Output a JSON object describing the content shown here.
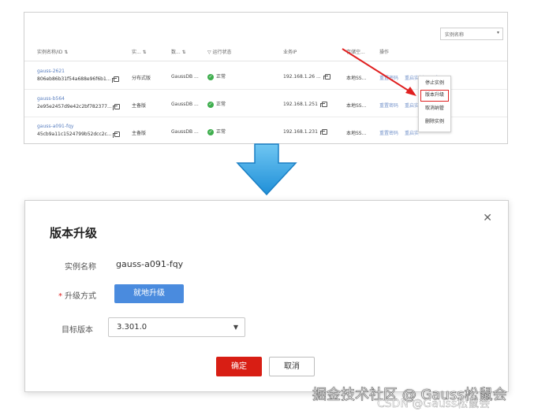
{
  "list": {
    "sort_select": "实例名称",
    "headers": {
      "name": "实例名称/ID",
      "type": "实...",
      "engine": "数...",
      "status": "运行状态",
      "ip": "业务IP",
      "storage": "存储空...",
      "ops": "操作"
    },
    "rows": [
      {
        "name": "gauss-2621",
        "id": "806eb86b31f54a688e96f6b1...",
        "type": "分布式版",
        "engine": "GaussDB ...",
        "status": "正常",
        "ip": "192.168.1.26 ...",
        "storage": "本地SS...",
        "op1": "重置密码",
        "op2": "重启实例",
        "more": "更多"
      },
      {
        "name": "gauss-b564",
        "id": "2e95e2457d9e42c2bf782377...",
        "type": "主备版",
        "engine": "GaussDB ...",
        "status": "正常",
        "ip": "192.168.1.251",
        "storage": "本地SS...",
        "op1": "重置密码",
        "op2": "重启实",
        "more": ""
      },
      {
        "name": "gauss-a091-fqy",
        "id": "45cb9a11c1524799b52dcc2c...",
        "type": "主备版",
        "engine": "GaussDB ...",
        "status": "正常",
        "ip": "192.168.1.231",
        "storage": "本地SS...",
        "op1": "重置密码",
        "op2": "重启实",
        "more": ""
      }
    ],
    "more_menu": [
      "停止实例",
      "版本升级",
      "取消纳管",
      "删除实例"
    ]
  },
  "colors": {
    "accent_blue": "#4a8bde",
    "danger_red": "#d81e14",
    "status_green": "#3fae4e",
    "arrow_blue": "#2a9ee0"
  },
  "dialog": {
    "title": "版本升级",
    "instance_label": "实例名称",
    "instance_value": "gauss-a091-fqy",
    "mode_label": "升级方式",
    "mode_button": "就地升级",
    "target_label": "目标版本",
    "target_value": "3.301.0",
    "confirm": "确定",
    "cancel": "取消"
  },
  "watermark": {
    "main": "掘金技术社区 @ Gauss松鼠会",
    "sub": "CSDN @Gauss松鼠会"
  }
}
